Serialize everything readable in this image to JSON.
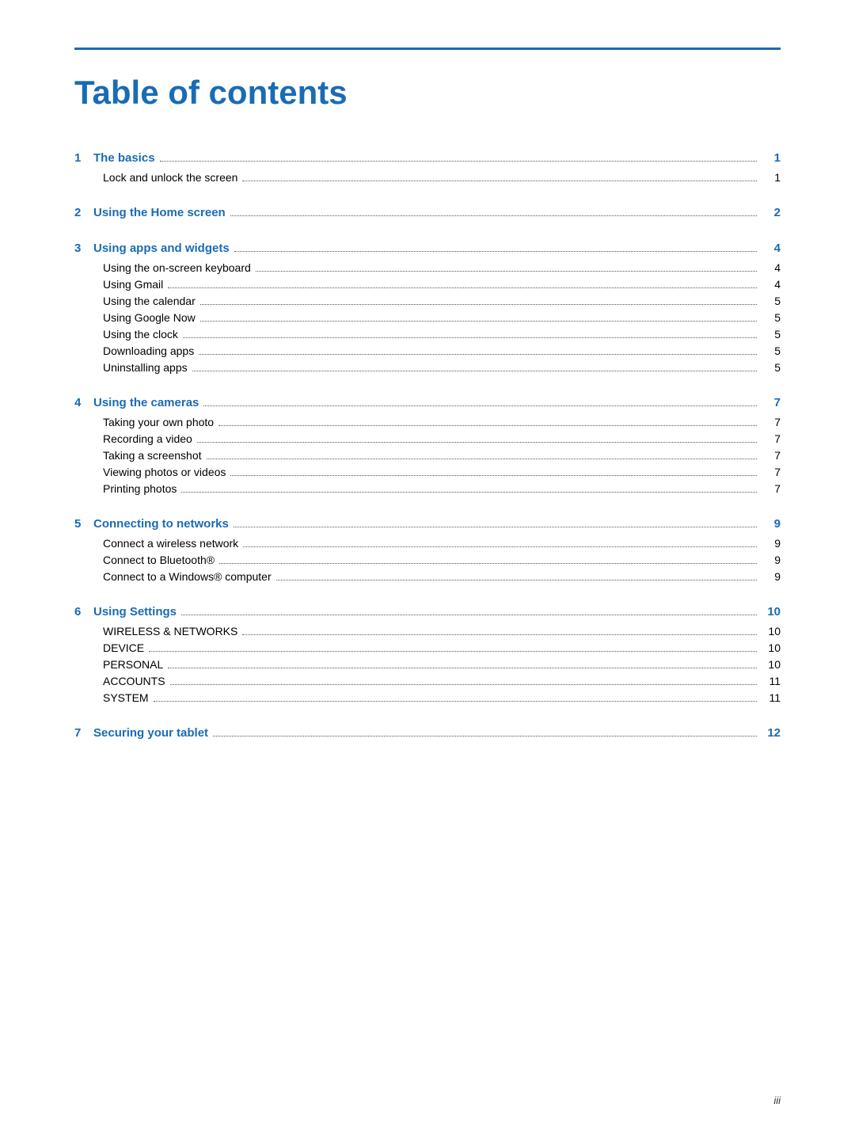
{
  "header": {
    "title": "Table of contents"
  },
  "chapters": [
    {
      "num": "1",
      "title": "The basics",
      "page": "1",
      "subsections": [
        {
          "title": "Lock and unlock the screen",
          "page": "1"
        }
      ]
    },
    {
      "num": "2",
      "title": "Using the Home screen",
      "page": "2",
      "subsections": []
    },
    {
      "num": "3",
      "title": "Using apps and widgets",
      "page": "4",
      "subsections": [
        {
          "title": "Using the on-screen keyboard",
          "page": "4"
        },
        {
          "title": "Using Gmail",
          "page": "4"
        },
        {
          "title": "Using the calendar",
          "page": "5"
        },
        {
          "title": "Using Google Now",
          "page": "5"
        },
        {
          "title": "Using the clock",
          "page": "5"
        },
        {
          "title": "Downloading apps",
          "page": "5"
        },
        {
          "title": "Uninstalling apps",
          "page": "5"
        }
      ]
    },
    {
      "num": "4",
      "title": "Using the cameras",
      "page": "7",
      "subsections": [
        {
          "title": "Taking your own photo",
          "page": "7"
        },
        {
          "title": "Recording a video",
          "page": "7"
        },
        {
          "title": "Taking a screenshot",
          "page": "7"
        },
        {
          "title": "Viewing photos or videos",
          "page": "7"
        },
        {
          "title": "Printing photos",
          "page": "7"
        }
      ]
    },
    {
      "num": "5",
      "title": "Connecting to networks",
      "page": "9",
      "subsections": [
        {
          "title": "Connect a wireless network",
          "page": "9"
        },
        {
          "title": "Connect to Bluetooth®",
          "page": "9"
        },
        {
          "title": "Connect to a Windows® computer",
          "page": "9"
        }
      ]
    },
    {
      "num": "6",
      "title": "Using Settings",
      "page": "10",
      "subsections": [
        {
          "title": "WIRELESS & NETWORKS",
          "page": "10"
        },
        {
          "title": "DEVICE",
          "page": "10"
        },
        {
          "title": "PERSONAL",
          "page": "10"
        },
        {
          "title": "ACCOUNTS",
          "page": "11"
        },
        {
          "title": "SYSTEM",
          "page": "11"
        }
      ]
    },
    {
      "num": "7",
      "title": "Securing your tablet",
      "page": "12",
      "subsections": []
    }
  ],
  "footer": {
    "page_label": "iii"
  }
}
